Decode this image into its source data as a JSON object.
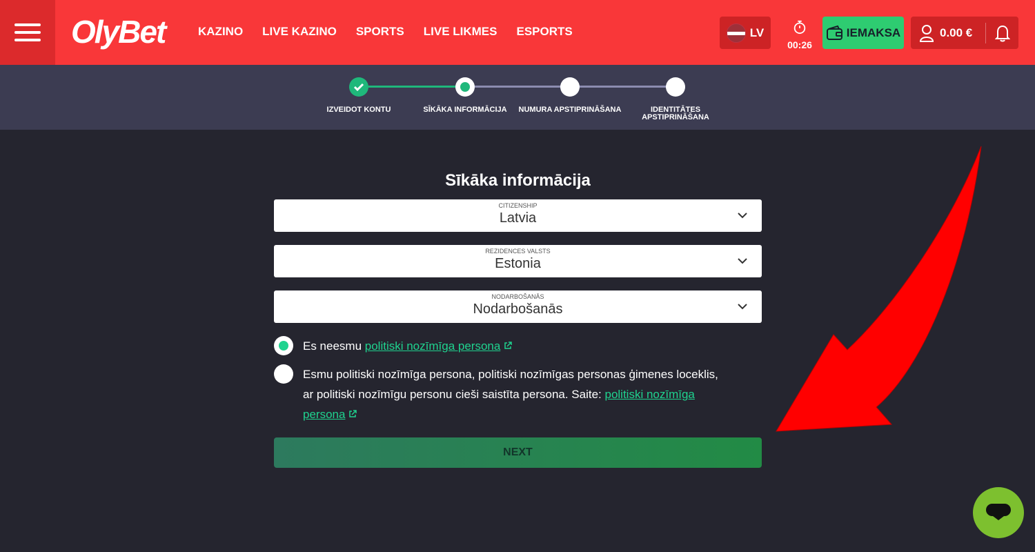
{
  "header": {
    "logo": "OlyBet",
    "nav": [
      "KAZINO",
      "LIVE KAZINO",
      "SPORTS",
      "LIVE LIKMES",
      "ESPORTS"
    ],
    "language": "LV",
    "timer": "00:26",
    "deposit_label": "IEMAKSA",
    "balance": "0.00 €"
  },
  "steps": {
    "items": [
      {
        "label": "IZVEIDOT KONTU",
        "state": "done"
      },
      {
        "label": "SĪKĀKA INFORMĀCIJA",
        "state": "current"
      },
      {
        "label": "NUMURA APSTIPRINĀŠANA",
        "state": "pending"
      },
      {
        "label_line1": "IDENTITĀTES",
        "label_line2": "APSTIPRINĀŠANA",
        "state": "pending"
      }
    ]
  },
  "form": {
    "title": "Sīkāka informācija",
    "citizenship": {
      "label": "CITIZENSHIP",
      "value": "Latvia"
    },
    "residence": {
      "label": "REZIDENCES VALSTS",
      "value": "Estonia"
    },
    "occupation": {
      "label": "NODARBOŠANĀS",
      "value": "Nodarbošanās"
    },
    "radio1": {
      "prefix": "Es neesmu ",
      "link": "politiski nozīmīga persona",
      "checked": true
    },
    "radio2": {
      "line1": "Esmu politiski nozīmīga persona, politiski nozīmīgas personas ģimenes loceklis,",
      "line2_prefix": "ar politiski nozīmīgu personu cieši saistīta persona. Saite: ",
      "link_part1": "politiski nozīmīga",
      "link_part2": "persona",
      "checked": false
    },
    "next_label": "NEXT"
  },
  "colors": {
    "header_bg": "#f93739",
    "accent_green": "#1fd38f",
    "deposit_green": "#2ecc71",
    "page_bg": "#25252f",
    "steps_bg": "#3c3c52",
    "chat_green": "#7dc02f",
    "arrow_red": "#ff0000"
  },
  "icons": [
    "menu-icon",
    "stopwatch-icon",
    "wallet-icon",
    "user-icon",
    "bell-icon",
    "check-icon",
    "chevron-down-icon",
    "external-link-icon",
    "chat-icon",
    "arrow-annotation"
  ]
}
